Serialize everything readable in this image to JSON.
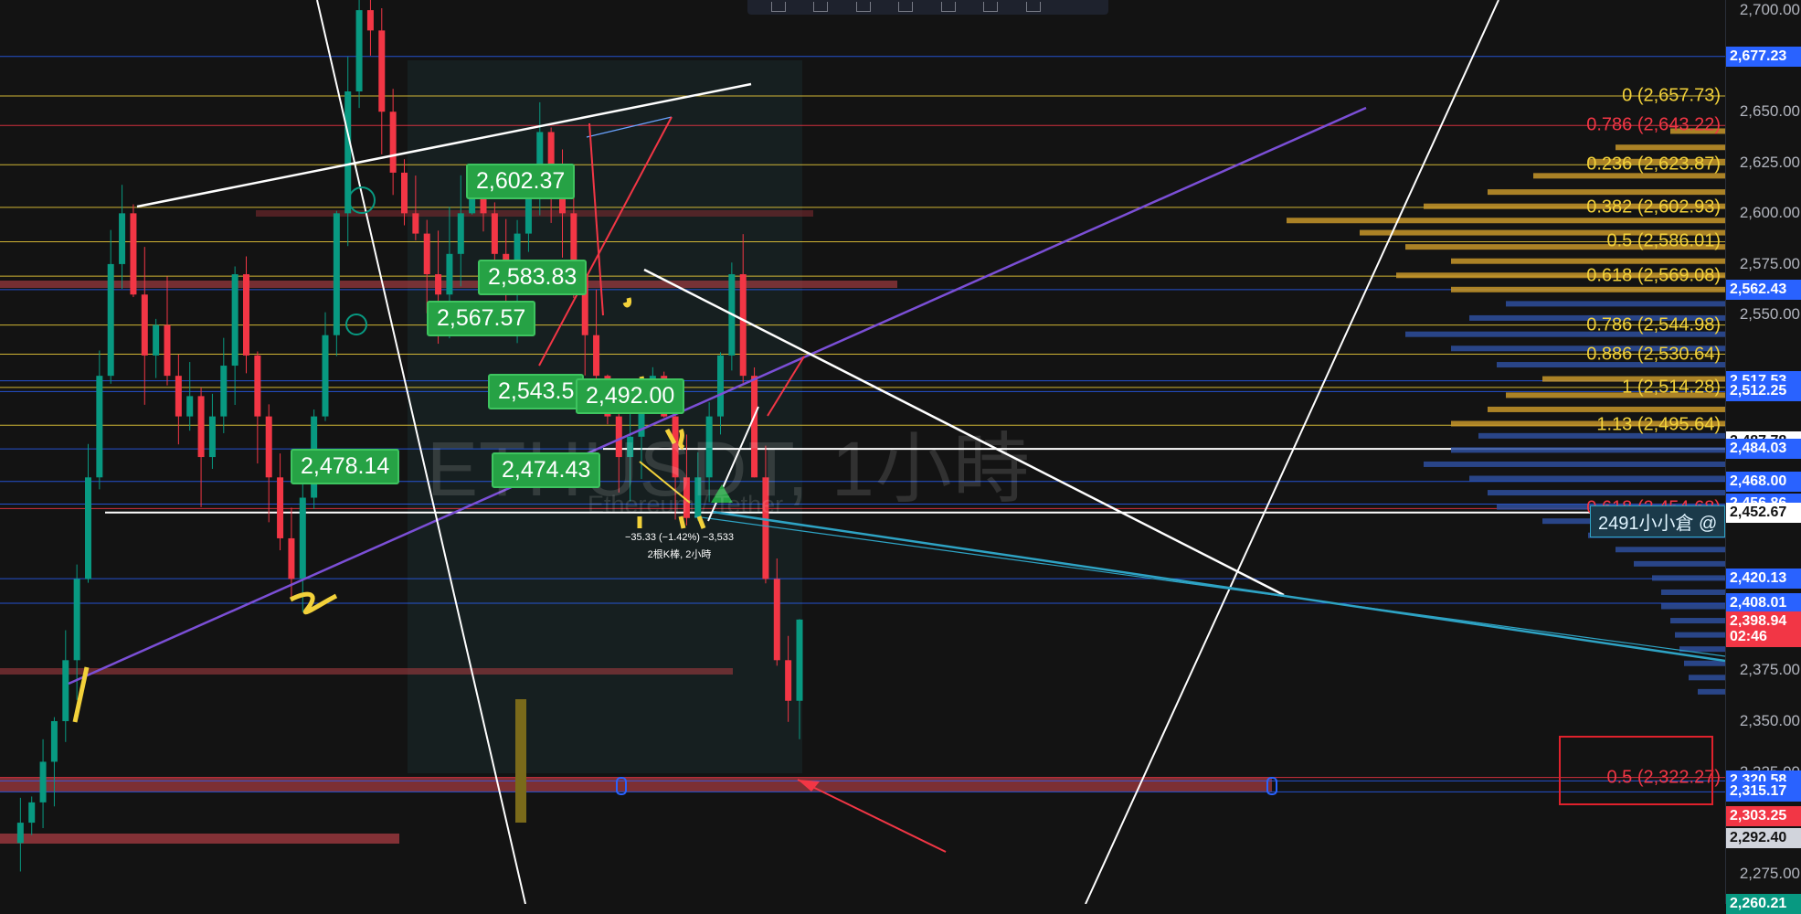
{
  "chart_data": {
    "type": "candlestick",
    "symbol_watermark": "ETHUSDT, 1小時",
    "symbol_sub": "Ethereum / Tether",
    "ylim": [
      2260,
      2705
    ],
    "y_ticks": [
      2700,
      2650,
      2625,
      2600,
      2575,
      2550,
      2375,
      2350,
      2325,
      2275
    ],
    "tick_labels": {
      "2700": "2,700.00",
      "2650": "2,650.00",
      "2625": "2,625.00",
      "2600": "2,600.00",
      "2575": "2,575.00",
      "2550": "2,550.00",
      "2375": "2,375.00",
      "2350": "2,350.00",
      "2325": "2,325.00",
      "2275": "2,275.00"
    },
    "price_labels": [
      {
        "value": 2677.23,
        "text": "2,677.23",
        "bg": "#2962ff",
        "fg": "#ffffff"
      },
      {
        "value": 2562.43,
        "text": "2,562.43",
        "bg": "#2962ff",
        "fg": "#ffffff"
      },
      {
        "value": 2517.53,
        "text": "2,517.53",
        "bg": "#2962ff",
        "fg": "#ffffff"
      },
      {
        "value": 2512.25,
        "text": "2,512.25",
        "bg": "#2962ff",
        "fg": "#ffffff"
      },
      {
        "value": 2487.78,
        "text": "2,487.78",
        "bg": "#ffffff",
        "fg": "#131313"
      },
      {
        "value": 2484.03,
        "text": "2,484.03",
        "bg": "#2962ff",
        "fg": "#ffffff"
      },
      {
        "value": 2468.0,
        "text": "2,468.00",
        "bg": "#2962ff",
        "fg": "#ffffff"
      },
      {
        "value": 2456.86,
        "text": "2,456.86",
        "bg": "#2962ff",
        "fg": "#ffffff"
      },
      {
        "value": 2452.67,
        "text": "2,452.67",
        "bg": "#ffffff",
        "fg": "#131313"
      },
      {
        "value": 2420.13,
        "text": "2,420.13",
        "bg": "#2962ff",
        "fg": "#ffffff"
      },
      {
        "value": 2408.01,
        "text": "2,408.01",
        "bg": "#2962ff",
        "fg": "#ffffff"
      },
      {
        "value": 2398.94,
        "text": "2,398.94",
        "bg": "#f23645",
        "fg": "#ffffff"
      },
      {
        "value": 2391.2,
        "text": "02:46",
        "bg": "#f23645",
        "fg": "#ffffff"
      },
      {
        "value": 2320.58,
        "text": "2,320.58",
        "bg": "#2962ff",
        "fg": "#ffffff"
      },
      {
        "value": 2315.17,
        "text": "2,315.17",
        "bg": "#2962ff",
        "fg": "#ffffff"
      },
      {
        "value": 2303.25,
        "text": "2,303.25",
        "bg": "#f23645",
        "fg": "#ffffff"
      },
      {
        "value": 2292.4,
        "text": "2,292.40",
        "bg": "#d1d4dc",
        "fg": "#131313"
      },
      {
        "value": 2260.21,
        "text": "2,260.21",
        "bg": "#089981",
        "fg": "#ffffff"
      }
    ],
    "fib_levels": [
      {
        "value": 2657.73,
        "text": "0 (2,657.73)",
        "color": "#f2d13a"
      },
      {
        "value": 2643.22,
        "text": "0.786 (2,643.22)",
        "color": "#f23645"
      },
      {
        "value": 2623.87,
        "text": "0.236 (2,623.87)",
        "color": "#f2d13a"
      },
      {
        "value": 2602.93,
        "text": "0.382 (2,602.93)",
        "color": "#f2d13a"
      },
      {
        "value": 2586.01,
        "text": "0.5 (2,586.01)",
        "color": "#f2d13a"
      },
      {
        "value": 2569.08,
        "text": "0.618 (2,569.08)",
        "color": "#f2d13a"
      },
      {
        "value": 2544.98,
        "text": "0.786 (2,544.98)",
        "color": "#f2d13a"
      },
      {
        "value": 2530.64,
        "text": "0.886 (2,530.64)",
        "color": "#f2d13a"
      },
      {
        "value": 2514.28,
        "text": "1 (2,514.28)",
        "color": "#f2d13a"
      },
      {
        "value": 2495.64,
        "text": "1.13 (2,495.64)",
        "color": "#f2d13a"
      },
      {
        "value": 2454.68,
        "text": "0.618 (2,454.68)",
        "color": "#f23645"
      },
      {
        "value": 2322.27,
        "text": "0.5 (2,322.27)",
        "color": "#f23645"
      }
    ],
    "blue_lines": [
      2677.23,
      2562.43,
      2517.53,
      2512.25,
      2484.03,
      2468.0,
      2456.86,
      2420.13,
      2408.01,
      2320.58,
      2315.17
    ],
    "callouts": [
      {
        "text": "2,602.37",
        "price": 2602.37
      },
      {
        "text": "2,583.83",
        "price": 2583.83
      },
      {
        "text": "2,567.57",
        "price": 2567.57
      },
      {
        "text": "2,543.5",
        "price": 2543.5
      },
      {
        "text": "2,492.00",
        "price": 2492.0
      },
      {
        "text": "2,478.14",
        "price": 2478.14
      },
      {
        "text": "2,474.43",
        "price": 2474.43
      }
    ],
    "measure_line1": "−35.33 (−1.42%) −3,533",
    "measure_line2": "2根K棒, 2小時",
    "position_label": "2491小小倉 @",
    "current_price": 2398.94,
    "countdown": "02:46"
  }
}
